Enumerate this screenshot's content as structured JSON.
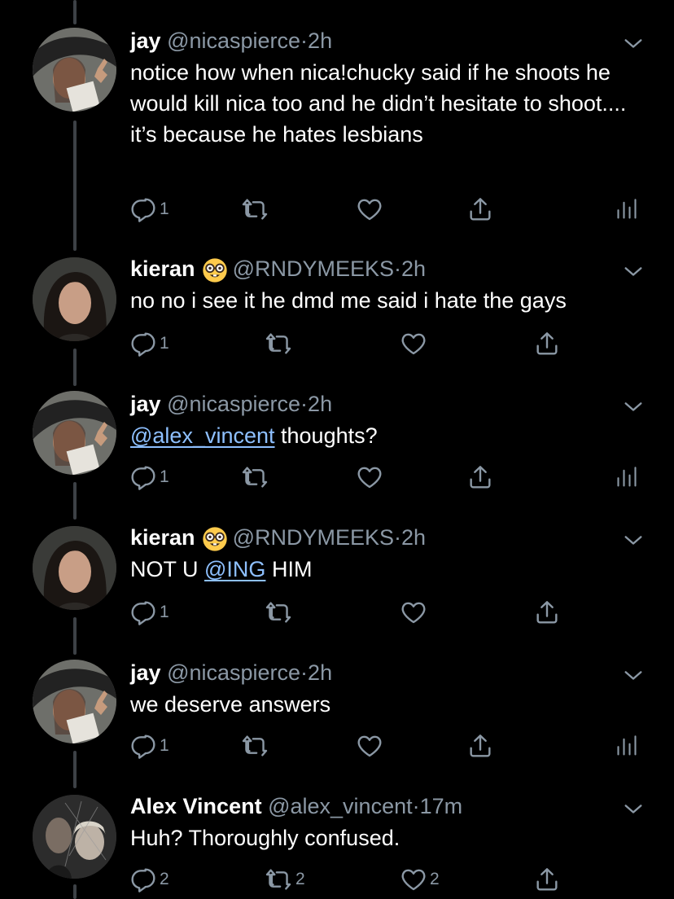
{
  "colors": {
    "background": "#000000",
    "text": "#ffffff",
    "secondary": "#8b98a5",
    "link": "#8ec0ff",
    "thread_line": "#3d4146"
  },
  "icons": {
    "reply": "reply-icon",
    "retweet": "retweet-icon",
    "like": "heart-icon",
    "share": "share-icon",
    "analytics": "analytics-icon",
    "more": "chevron-down-icon",
    "nerd_emoji": "nerd-face-emoji"
  },
  "tweets": [
    {
      "name": "jay",
      "handle": "@nicaspierce",
      "dot": "·",
      "time": "2h",
      "text": "notice how when nica!chucky said if he shoots he would kill nica too and he didn’t hesitate to shoot.... it’s because he hates lesbians",
      "replies": "1",
      "retweets": "",
      "likes": ""
    },
    {
      "name": "kieran",
      "handle": "@RNDYMEEKS",
      "dot": "·",
      "time": "2h",
      "text": "no no i see it he dmd me said i hate the gays",
      "replies": "1",
      "retweets": "",
      "likes": ""
    },
    {
      "name": "jay",
      "handle": "@nicaspierce",
      "dot": "·",
      "time": "2h",
      "mention": "@alex_vincent",
      "text_after": " thoughts?",
      "replies": "1",
      "retweets": "",
      "likes": ""
    },
    {
      "name": "kieran",
      "handle": "@RNDYMEEKS",
      "dot": "·",
      "time": "2h",
      "text_before": "NOT U ",
      "mention": "@ING",
      "text_after": " HIM",
      "replies": "1",
      "retweets": "",
      "likes": ""
    },
    {
      "name": "jay",
      "handle": "@nicaspierce",
      "dot": "·",
      "time": "2h",
      "text": "we deserve answers",
      "replies": "1",
      "retweets": "",
      "likes": ""
    },
    {
      "name": "Alex Vincent",
      "handle": "@alex_vincent",
      "dot": "·",
      "time": "17m",
      "text": "Huh? Thoroughly confused.",
      "replies": "2",
      "retweets": "2",
      "likes": "2"
    }
  ]
}
